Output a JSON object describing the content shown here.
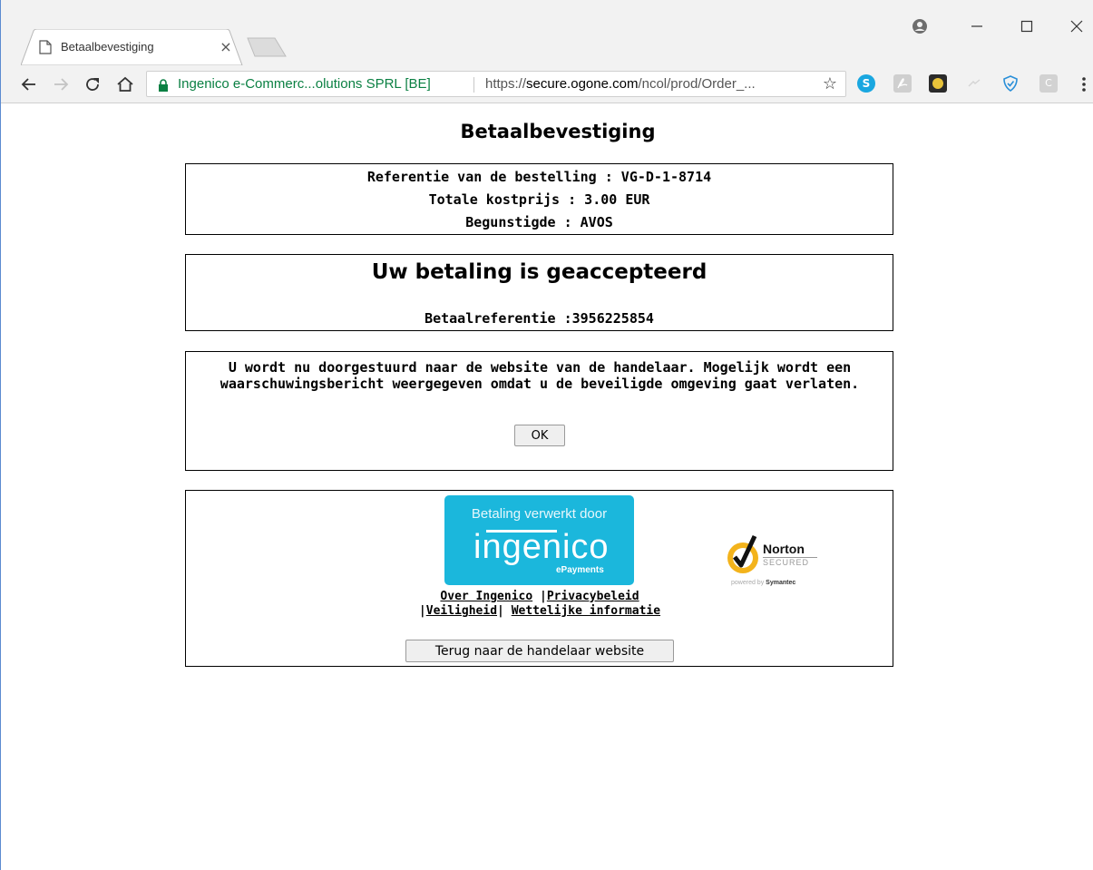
{
  "browser": {
    "tab": {
      "title": "Betaalbevestiging",
      "close_glyph": "×"
    },
    "window_controls": {
      "profile": "profile-icon",
      "minimize": "–",
      "maximize": "☐",
      "close": "✕"
    },
    "omnibox": {
      "site_identity": "Ingenico e-Commerc...olutions SPRL [BE]",
      "url_scheme": "https://",
      "url_host": "secure.ogone.com",
      "url_path": "/ncol/prod/Order_...",
      "bookmark_icon": "star-icon"
    },
    "extensions": [
      "skype-icon",
      "acrobat-icon",
      "check-icon",
      "ghost-icon",
      "shield-icon",
      "c-icon"
    ],
    "extension_labels": {
      "skype": "S",
      "c": "C"
    }
  },
  "page": {
    "title": "Betaalbevestiging",
    "order": {
      "reference": "Referentie van de bestelling : VG-D-1-8714",
      "total": "Totale kostprijs : 3.00 EUR",
      "beneficiary": "Begunstigde : AVOS"
    },
    "status": {
      "headline": "Uw betaling is geaccepteerd",
      "payment_reference": "Betaalreferentie :3956225854"
    },
    "redirect": {
      "message": "U wordt nu doorgestuurd naar de website van de handelaar. Mogelijk wordt een waarschuwingsbericht weergegeven omdat u de beveiligde omgeving gaat verlaten.",
      "ok_label": "OK"
    },
    "footer": {
      "logo": {
        "caption": "Betaling verwerkt door",
        "brand": "ingenico",
        "sub": "ePayments"
      },
      "norton": {
        "brand": "Norton",
        "secured": "SECURED",
        "powered_by": "powered by",
        "company": "Symantec"
      },
      "links": {
        "about": "Over Ingenico",
        "privacy": "Privacybeleid",
        "security": "Veiligheid",
        "legal": "Wettelijke informatie"
      },
      "separator": "|",
      "back_button": "Terug naar de handelaar website"
    }
  },
  "colors": {
    "chrome_bg": "#f2f2f2",
    "secure_green": "#0b8043",
    "ingenico_blue": "#1bb7dc",
    "norton_yellow": "#f3b31c"
  }
}
